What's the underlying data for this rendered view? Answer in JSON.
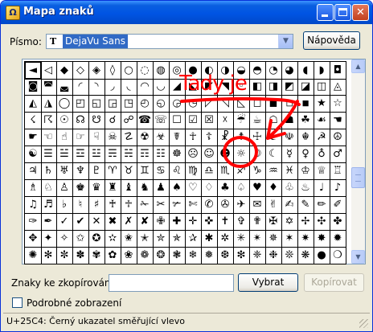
{
  "window": {
    "title": "Mapa znaků",
    "app_icon": "character-map-icon",
    "buttons": {
      "minimize": "minimize-icon",
      "maximize": "maximize-icon",
      "close": "close-icon"
    }
  },
  "font_row": {
    "label": "Písmo:",
    "font_icon_glyph": "T",
    "selected_font": "DejaVu Sans",
    "dropdown_arrow": "▼",
    "help_button": "Nápověda"
  },
  "grid": {
    "rows": [
      [
        "◄",
        "◁",
        "◆",
        "◇",
        "◈",
        "◊",
        "○",
        "◌",
        "◍",
        "◎",
        "●",
        "◐",
        "◑",
        "◒",
        "◓",
        "◔",
        "◕",
        "◖",
        "◗",
        "◘"
      ],
      [
        "◙",
        "◚",
        "◛",
        "◜",
        "◝",
        "◞",
        "◟",
        "◠",
        "◡",
        "◢",
        "◣",
        "◤",
        "◥",
        "◦",
        "◧",
        "◨",
        "◩",
        "◪",
        "◫",
        "◬"
      ],
      [
        "◭",
        "◮",
        "◯",
        "◰",
        "◱",
        "◲",
        "◳",
        "◴",
        "◵",
        "◶",
        "◷",
        "◸",
        "◹",
        "◺",
        "◻",
        "◼",
        "◽",
        "◾",
        "★",
        "☆"
      ],
      [
        "☇",
        "☈",
        "☉",
        "☊",
        "☋",
        "☌",
        "☍",
        "☎",
        "☏",
        "☐",
        "☑",
        "☒",
        "☓",
        "☔",
        "☕",
        "☖",
        "☗",
        "☘",
        "☙",
        "☚"
      ],
      [
        "☛",
        "☜",
        "☝",
        "☞",
        "☟",
        "☠",
        "☡",
        "☢",
        "☣",
        "☤",
        "☥",
        "☦",
        "☧",
        "☨",
        "☩",
        "☪",
        "☫",
        "☬",
        "☭",
        "☮"
      ],
      [
        "☯",
        "☰",
        "☱",
        "☲",
        "☳",
        "☴",
        "☵",
        "☶",
        "☷",
        "☸",
        "☹",
        "☺",
        "☻",
        "☼",
        "☽",
        "☾",
        "☿",
        "♀",
        "♁",
        "♂"
      ],
      [
        "♃",
        "♄",
        "♅",
        "♆",
        "♇",
        "♈",
        "♉",
        "♊",
        "♋",
        "♌",
        "♍",
        "♎",
        "♏",
        "♐",
        "♑",
        "♒",
        "♓",
        "♔",
        "♕",
        "♖"
      ],
      [
        "♗",
        "♘",
        "♙",
        "♚",
        "♛",
        "♜",
        "♝",
        "♞",
        "♟",
        "♠",
        "♡",
        "♢",
        "♣",
        "♤",
        "♥",
        "♦",
        "♧",
        "♨",
        "♩",
        "♪"
      ],
      [
        "♫",
        "♬",
        "♭",
        "♮",
        "♯",
        "♰",
        "♱",
        "✁",
        "✂",
        "✃",
        "✄",
        "✆",
        "✇",
        "✈",
        "✉",
        "✌",
        "✍",
        "✎",
        "✏",
        "✐"
      ],
      [
        "✑",
        "✒",
        "✓",
        "✔",
        "✕",
        "✖",
        "✗",
        "✘",
        "✙",
        "✚",
        "✛",
        "✜",
        "✝",
        "✞",
        "✟",
        "✠",
        "✡",
        "✢",
        "✣",
        "✤"
      ],
      [
        "✥",
        "✦",
        "✧",
        "✩",
        "✪",
        "✫",
        "✬",
        "✭",
        "✮",
        "✯",
        "✰",
        "✱",
        "✲",
        "✳",
        "✴",
        "✵",
        "✶",
        "✷",
        "✸",
        "✹"
      ],
      [
        "✺",
        "✻",
        "✼",
        "✽",
        "✾",
        "✿",
        "❀",
        "❁",
        "❂",
        "❃",
        "❄",
        "❅",
        "❆",
        "❇",
        "❈",
        "❉",
        "❊",
        "❋",
        "●",
        "❍"
      ]
    ],
    "selected_index": [
      0,
      0
    ]
  },
  "copy_row": {
    "label": "Znaky ke zkopírování:",
    "value": "",
    "select_button": "Vybrat",
    "copy_button": "Kopírovat"
  },
  "advanced": {
    "checkbox_label": "Podrobné zobrazení",
    "checked": false
  },
  "status": {
    "text": "U+25C4: Černý ukazatel směřující vlevo"
  },
  "annotation": {
    "text": "Tady je",
    "color": "#ff0000"
  },
  "colors": {
    "title_bar": "#0054e3",
    "window_bg": "#ece9d8",
    "selection": "#316ac5",
    "annotation": "#ff0000"
  }
}
